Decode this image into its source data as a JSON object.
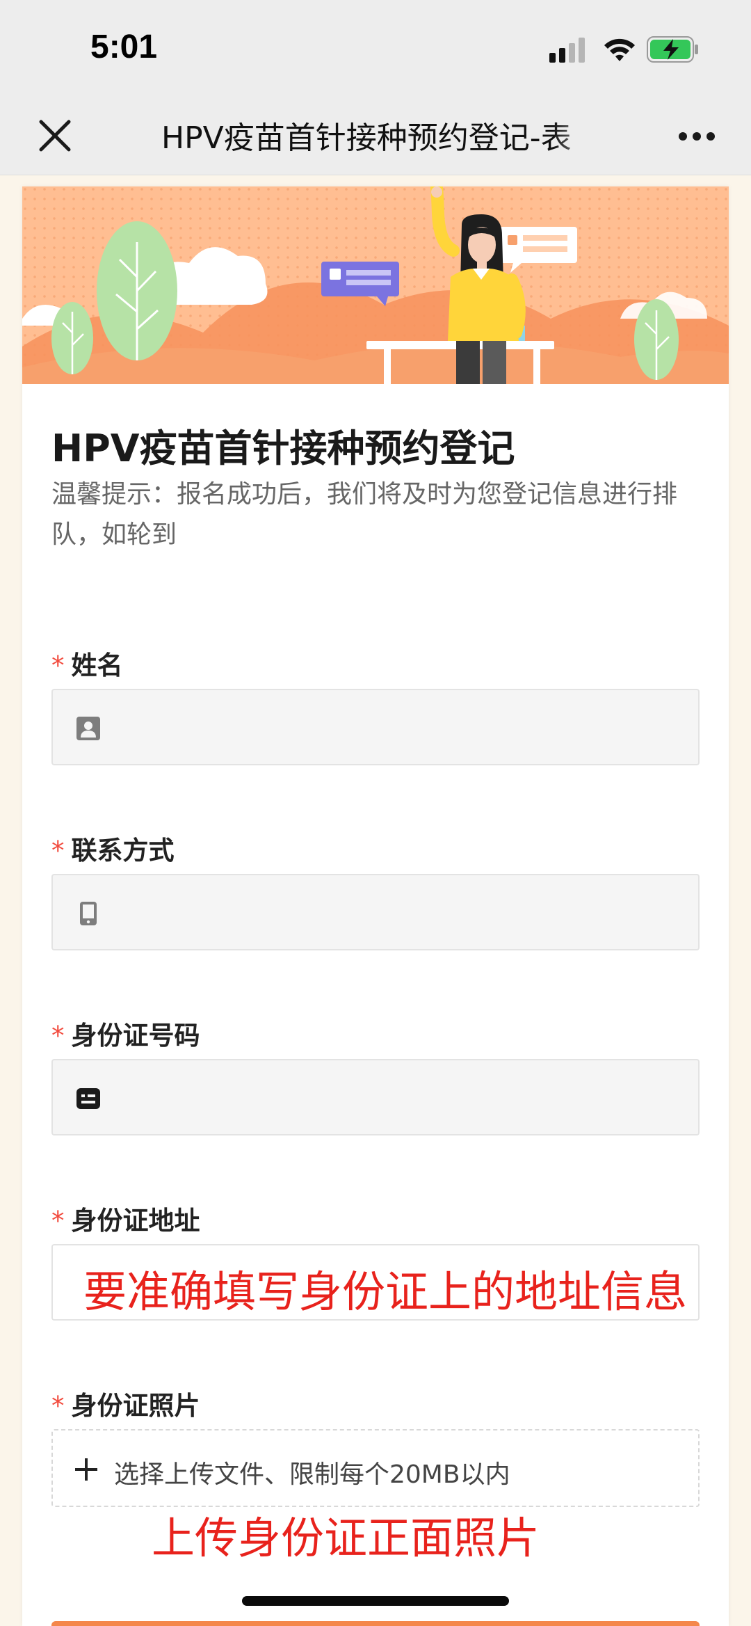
{
  "status_bar": {
    "time": "5:01"
  },
  "nav": {
    "title": "HPV疫苗首针接种预约登记-表"
  },
  "form": {
    "title": "HPV疫苗首针接种预约登记",
    "tip": "温馨提示：报名成功后，我们将及时为您登记信息进行排队，如轮到",
    "fields": [
      {
        "required_mark": "*",
        "label": "姓名",
        "icon": "person-icon"
      },
      {
        "required_mark": "*",
        "label": "联系方式",
        "icon": "phone-icon"
      },
      {
        "required_mark": "*",
        "label": "身份证号码",
        "icon": "id-card-icon"
      },
      {
        "required_mark": "*",
        "label": "身份证地址",
        "annotation": "要准确填写身份证上的地址信息"
      },
      {
        "required_mark": "*",
        "label": "身份证照片",
        "upload_text": "选择上传文件、限制每个20MB以内",
        "annotation": "上传身份证正面照片"
      }
    ]
  },
  "colors": {
    "accent": "#f4874b",
    "required": "#f24b3e",
    "annotation": "#e8221c",
    "page_bg": "#fbf5ea"
  }
}
